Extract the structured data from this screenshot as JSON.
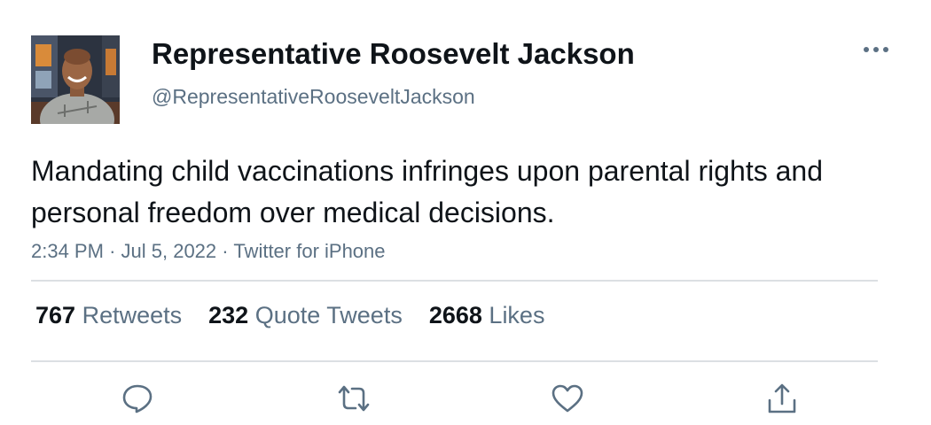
{
  "author": {
    "display_name": "Representative Roosevelt Jackson",
    "handle": "@RepresentativeRooseveltJackson"
  },
  "tweet": {
    "text": "Mandating child vaccinations infringes upon parental rights and personal freedom over medical decisions.",
    "time": "2:34 PM",
    "date": "Jul 5, 2022",
    "source": "Twitter for iPhone",
    "separator": "·"
  },
  "stats": {
    "retweets_count": "767",
    "retweets_label": "Retweets",
    "quotes_count": "232",
    "quotes_label": "Quote Tweets",
    "likes_count": "2668",
    "likes_label": "Likes"
  },
  "icons": {
    "more": "more-horizontal-icon",
    "reply": "comment-icon",
    "retweet": "retweet-icon",
    "like": "heart-icon",
    "share": "share-icon"
  },
  "colors": {
    "text_primary": "#0f1419",
    "text_secondary": "#5b7083",
    "divider": "#dcdfe3",
    "icon": "#5b7083"
  }
}
